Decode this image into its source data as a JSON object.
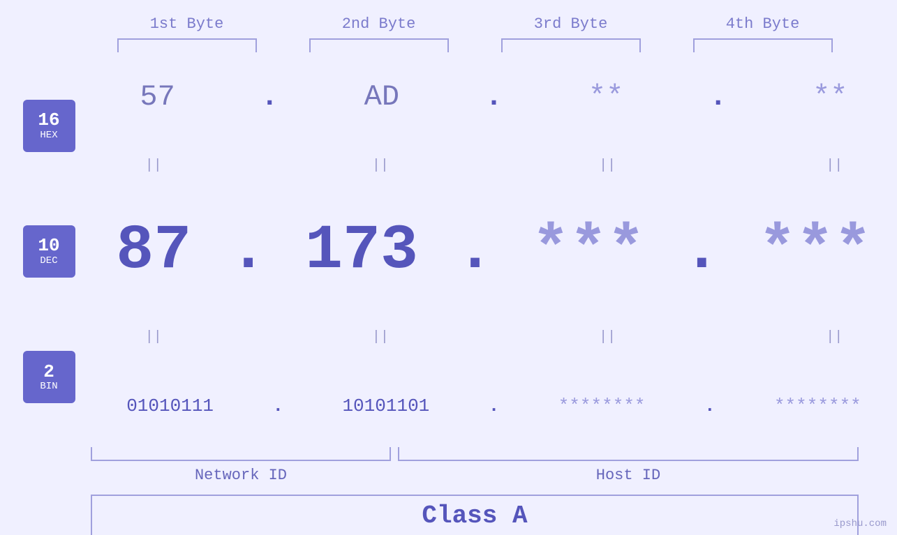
{
  "bytes": {
    "labels": [
      "1st Byte",
      "2nd Byte",
      "3rd Byte",
      "4th Byte"
    ]
  },
  "badges": [
    {
      "num": "16",
      "label": "HEX"
    },
    {
      "num": "10",
      "label": "DEC"
    },
    {
      "num": "2",
      "label": "BIN"
    }
  ],
  "hex_row": {
    "values": [
      "57",
      "AD",
      "**",
      "**"
    ],
    "dots": [
      ".",
      ".",
      ".",
      ""
    ]
  },
  "dec_row": {
    "values": [
      "87",
      "173",
      "***",
      "***"
    ],
    "dots": [
      ".",
      ".",
      ".",
      ""
    ]
  },
  "bin_row": {
    "values": [
      "01010111",
      "10101101",
      "********",
      "********"
    ],
    "dots": [
      ".",
      ".",
      ".",
      ""
    ]
  },
  "labels": {
    "network_id": "Network ID",
    "host_id": "Host ID",
    "class": "Class A",
    "watermark": "ipshu.com"
  }
}
